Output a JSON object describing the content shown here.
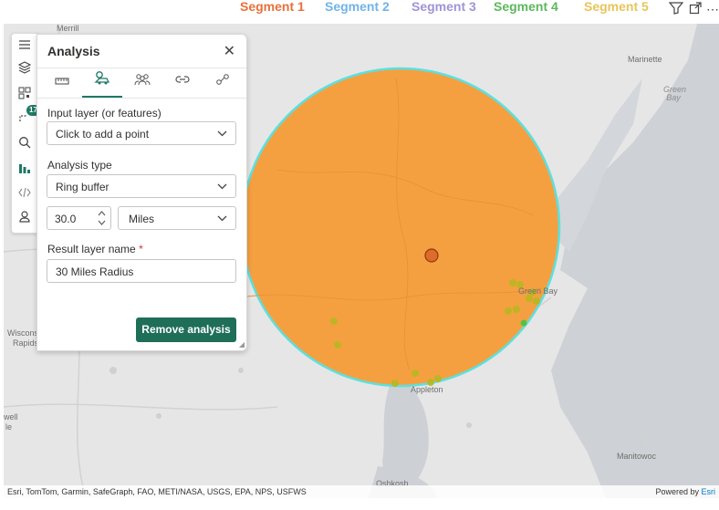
{
  "legend": [
    {
      "label": "Segment 1",
      "color": "#e8703a"
    },
    {
      "label": "Segment 2",
      "color": "#6fb4e8"
    },
    {
      "label": "Segment 3",
      "color": "#a093d6"
    },
    {
      "label": "Segment 4",
      "color": "#5cb85c"
    },
    {
      "label": "Segment 5",
      "color": "#e8c45a"
    }
  ],
  "topbar": {
    "filter_icon": "filter-icon",
    "expand_icon": "expand-icon",
    "more_icon": "more-icon"
  },
  "map": {
    "labels": {
      "merrill": "Merrill",
      "marinette": "Marinette",
      "green_bay_water": "Green Bay",
      "green_bay_city": "Green Bay",
      "wisconsin_rapids_1": "Wiscons",
      "wisconsin_rapids_2": "Rapids",
      "appleton": "Appleton",
      "oshkosh": "Oshkosh",
      "manitowoc": "Manitowoc",
      "shawano": "well",
      "shawano2": "le"
    },
    "buffer_color": "#f5a040",
    "buffer_outline": "#5ce0e0",
    "attribution": "Esri, TomTom, Garmin, SafeGraph, FAO, METI/NASA, USGS, EPA, NPS, USFWS",
    "powered_by": "Powered by",
    "powered_by_brand": "Esri"
  },
  "toolstrip": {
    "items": [
      "menu-icon",
      "layers-icon",
      "qr-icon",
      "route-icon",
      "search-icon",
      "chart-icon",
      "code-icon",
      "person-pin-icon"
    ],
    "route_badge": "17"
  },
  "panel": {
    "title": "Analysis",
    "input_layer_label": "Input layer (or features)",
    "input_layer_value": "Click to add a point",
    "analysis_type_label": "Analysis type",
    "analysis_type_value": "Ring buffer",
    "distance_value": "30.0",
    "unit_value": "Miles",
    "result_name_label": "Result layer name",
    "required_marker": "*",
    "result_name_value": "30 Miles Radius",
    "remove_button": "Remove analysis"
  }
}
